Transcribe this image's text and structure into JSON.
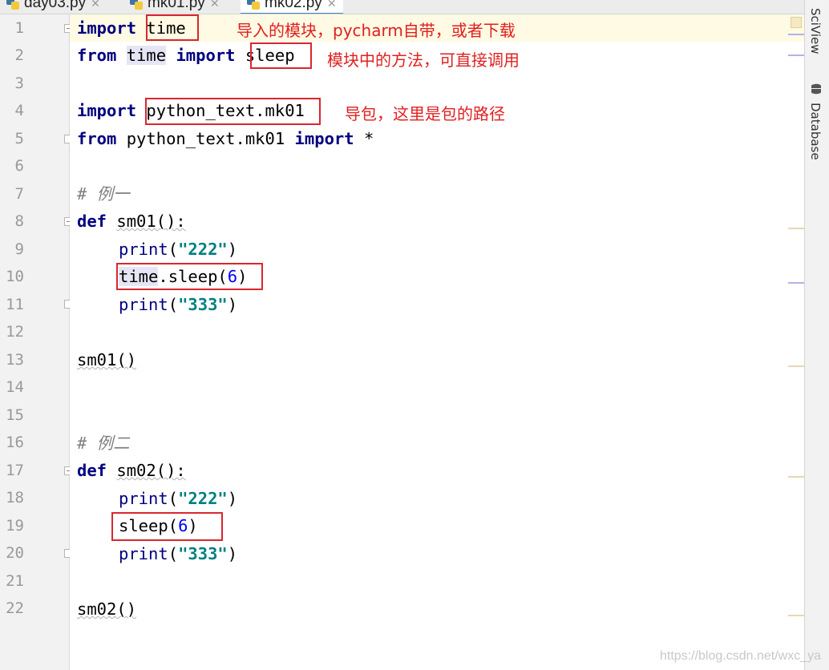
{
  "tabs": [
    {
      "label": "day03.py",
      "active": false
    },
    {
      "label": "mk01.py",
      "active": false
    },
    {
      "label": "mk02.py",
      "active": true
    }
  ],
  "line_numbers": [
    "1",
    "2",
    "3",
    "4",
    "5",
    "6",
    "7",
    "8",
    "9",
    "10",
    "11",
    "12",
    "13",
    "14",
    "15",
    "16",
    "17",
    "18",
    "19",
    "20",
    "21",
    "22"
  ],
  "code": {
    "l1": {
      "kw": "import",
      "mod": "time"
    },
    "l2": {
      "kw1": "from",
      "mod": "time",
      "kw2": "import",
      "name": "sleep"
    },
    "l4": {
      "kw": "import",
      "mod": "python_text.mk01"
    },
    "l5": {
      "kw1": "from",
      "mod": "python_text.mk01",
      "kw2": "import",
      "star": "*"
    },
    "l7": {
      "comment": "# 例一"
    },
    "l8": {
      "kw": "def",
      "sig": "sm01():"
    },
    "l9": {
      "fn": "print",
      "open": "(",
      "str": "\"222\"",
      "close": ")"
    },
    "l10": {
      "obj": "time",
      "call": ".sleep(",
      "num": "6",
      "close": ")"
    },
    "l11": {
      "fn": "print",
      "open": "(",
      "str": "\"333\"",
      "close": ")"
    },
    "l13": {
      "call": "sm01()"
    },
    "l16": {
      "comment": "# 例二"
    },
    "l17": {
      "kw": "def",
      "sig": "sm02():"
    },
    "l18": {
      "fn": "print",
      "open": "(",
      "str": "\"222\"",
      "close": ")"
    },
    "l19": {
      "call": "sleep(",
      "num": "6",
      "close": ")"
    },
    "l20": {
      "fn": "print",
      "open": "(",
      "str": "\"333\"",
      "close": ")"
    },
    "l22": {
      "call": "sm02()"
    }
  },
  "annotations": {
    "a1": "导入的模块，pycharm自带，或者下载",
    "a2": "模块中的方法，可直接调用",
    "a3": "导包，这里是包的路径"
  },
  "right_tools": {
    "sciview": "SciView",
    "database": "Database"
  },
  "watermark": "https://blog.csdn.net/wxc_ya",
  "colors": {
    "keyword": "#000080",
    "string": "#008080",
    "number": "#0000ff",
    "comment": "#808080",
    "annotation_red": "#d9272e",
    "current_line": "#fffae3"
  },
  "icons": [
    "python-file-icon",
    "close-icon",
    "fold-icon",
    "database-icon"
  ]
}
